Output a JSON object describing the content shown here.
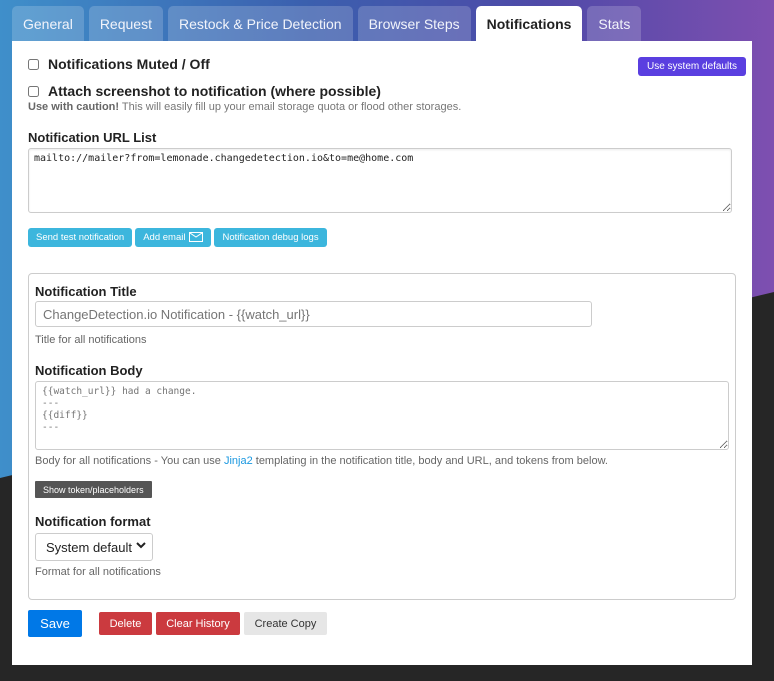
{
  "tabs": [
    {
      "label": "General",
      "active": false
    },
    {
      "label": "Request",
      "active": false
    },
    {
      "label": "Restock & Price Detection",
      "active": false
    },
    {
      "label": "Browser Steps",
      "active": false
    },
    {
      "label": "Notifications",
      "active": true
    },
    {
      "label": "Stats",
      "active": false
    }
  ],
  "notifications": {
    "muted_label": "Notifications Muted / Off",
    "muted_checked": false,
    "use_defaults_label": "Use system defaults",
    "attach_label": "Attach screenshot to notification (where possible)",
    "attach_checked": false,
    "caution_bold": "Use with caution!",
    "caution_text": " This will easily fill up your email storage quota or flood other storages.",
    "url_list_label": "Notification URL List",
    "url_list_value": "mailto://mailer?from=lemonade.changedetection.io&to=me@home.com",
    "send_test_label": "Send test notification",
    "add_email_label": "Add email",
    "debug_logs_label": "Notification debug logs",
    "title_label": "Notification Title",
    "title_placeholder": "ChangeDetection.io Notification - {{watch_url}}",
    "title_hint": "Title for all notifications",
    "body_label": "Notification Body",
    "body_placeholder": "{{watch_url}} had a change.\n---\n{{diff}}\n---",
    "body_hint_pre": "Body for all notifications - You can use ",
    "body_hint_link": "Jinja2",
    "body_hint_post": " templating in the notification title, body and URL, and tokens from below.",
    "show_tokens_label": "Show token/placeholders",
    "format_label": "Notification format",
    "format_selected": "System default",
    "format_hint": "Format for all notifications"
  },
  "actions": {
    "save": "Save",
    "delete": "Delete",
    "clear_history": "Clear History",
    "create_copy": "Create Copy"
  },
  "colors": {
    "primary": "#0078e7",
    "danger": "#d9534f",
    "info": "#3cb6dd",
    "purple": "#5a3fe0"
  }
}
